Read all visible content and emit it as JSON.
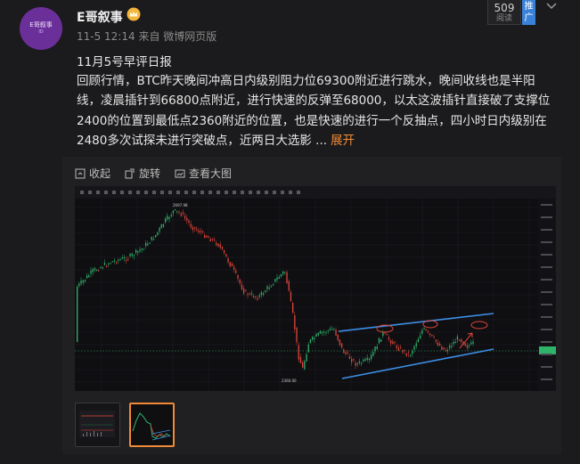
{
  "user": {
    "name": "E哥叙事",
    "avatar_text": "E哥叙事",
    "avatar_sub": "ID",
    "crown_icon": "crown-icon"
  },
  "post": {
    "meta": "11-5 12:14 来自 微博网页版",
    "title": "11月5号早评日报",
    "body": "回顾行情，BTC昨天晚间冲高日内级别阻力位69300附近进行跳水，晚间收线也是半阳线，凌晨插针到66800点附近，进行快速的反弹至68000，以太这波插针直接破了支撑位2400的位置到最低点2360附近的位置，也是快速的进行一个反抽点，四小时日内级别在2480多次试探未进行突破点，近两日大选影 ...",
    "expand_label": "展开"
  },
  "stats": {
    "read_count": "509",
    "read_label": "阅读",
    "promo_label": "推广"
  },
  "toolbar": {
    "collapse_label": "收起",
    "rotate_label": "旋转",
    "view_large_label": "查看大图"
  },
  "colors": {
    "up": "#2fb36a",
    "down": "#e0453a",
    "channel": "#3d8fe8",
    "accent": "#f08a36"
  },
  "chart_data": {
    "type": "candlestick",
    "high_label": "2697.98",
    "low_label": "2360.00"
  },
  "thumbnails": [
    {
      "name": "thumb-1"
    },
    {
      "name": "thumb-2"
    }
  ]
}
